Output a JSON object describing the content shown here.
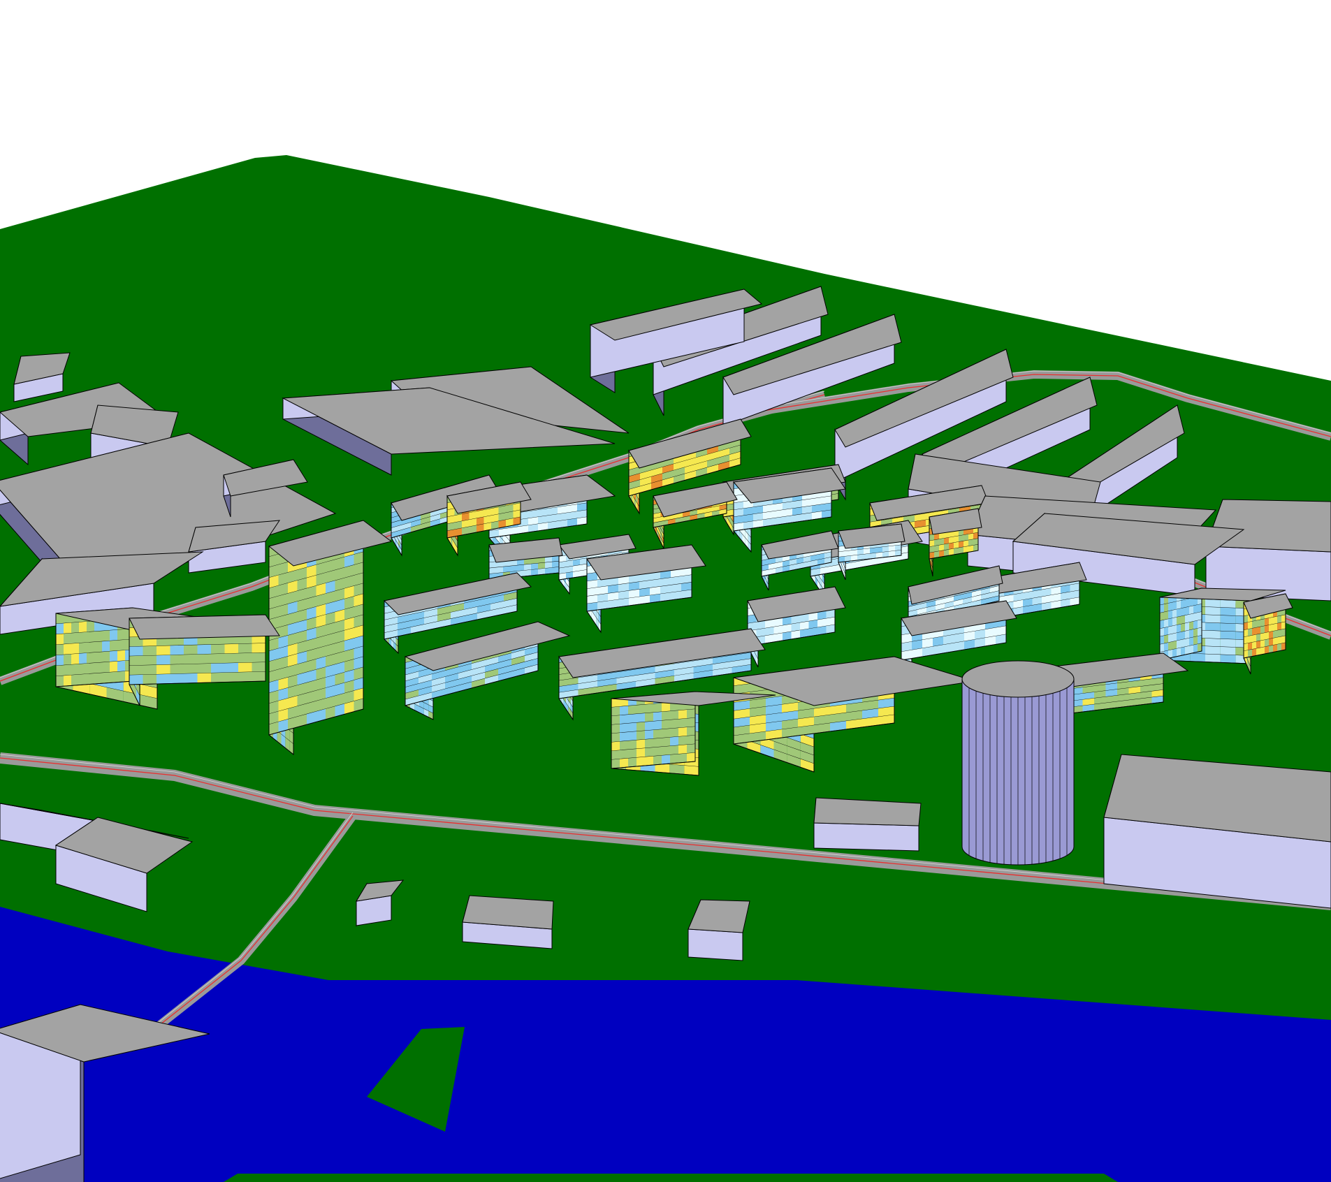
{
  "view": {
    "kind": "3d-urban-model-render",
    "palette": {
      "background": "#ffffff",
      "ground": "#007000",
      "water": "#0000c0",
      "road": "#9a9a9a",
      "road_line": "#e83030",
      "roof": "#a3a3a3",
      "wall_lit": "#c9c9f0",
      "wall_dark": "#6e6e9a",
      "outline": "#000000"
    },
    "facade_scale_colors": [
      "#e8fbff",
      "#b8e4f7",
      "#80c8ef",
      "#a0c878",
      "#f5e850",
      "#e89030"
    ]
  },
  "district": {
    "roads_count": 5,
    "buildings": [
      {
        "id": "b01",
        "style": "plain"
      },
      {
        "id": "b02",
        "style": "plain"
      },
      {
        "id": "b03",
        "style": "plain"
      },
      {
        "id": "b04",
        "style": "plain"
      },
      {
        "id": "b05",
        "style": "plain"
      },
      {
        "id": "b06",
        "style": "plain"
      },
      {
        "id": "b07",
        "style": "plain"
      },
      {
        "id": "b08",
        "style": "plain"
      },
      {
        "id": "b09",
        "style": "plain"
      },
      {
        "id": "b10",
        "style": "plain"
      },
      {
        "id": "b11",
        "style": "plain"
      },
      {
        "id": "b12",
        "style": "plain"
      },
      {
        "id": "b13",
        "style": "plain"
      },
      {
        "id": "b14",
        "style": "plain"
      },
      {
        "id": "b15",
        "style": "plain"
      },
      {
        "id": "b16",
        "style": "plain"
      },
      {
        "id": "b17",
        "style": "plain"
      },
      {
        "id": "b18",
        "style": "plain"
      },
      {
        "id": "b19",
        "style": "plain"
      },
      {
        "id": "b20",
        "style": "plain"
      },
      {
        "id": "b21",
        "style": "plain"
      },
      {
        "id": "b22",
        "style": "plain"
      },
      {
        "id": "b23",
        "style": "plain"
      },
      {
        "id": "b24",
        "style": "plain"
      },
      {
        "id": "b25",
        "style": "plain"
      },
      {
        "id": "b26",
        "style": "plain"
      },
      {
        "id": "b27",
        "style": "plain"
      },
      {
        "id": "b28",
        "style": "plain"
      },
      {
        "id": "b29",
        "style": "plain"
      },
      {
        "id": "b30",
        "style": "plain"
      },
      {
        "id": "b31",
        "style": "plain"
      },
      {
        "id": "h01",
        "style": "heatmap",
        "floors": 7,
        "tone": "light"
      },
      {
        "id": "h02",
        "style": "heatmap",
        "floors": 7,
        "tone": "light"
      },
      {
        "id": "h03",
        "style": "heatmap",
        "floors": 7,
        "tone": "light"
      },
      {
        "id": "h04",
        "style": "heatmap",
        "floors": 6,
        "tone": "light"
      },
      {
        "id": "h05",
        "style": "heatmap",
        "floors": 5,
        "tone": "light"
      },
      {
        "id": "h06",
        "style": "heatmap",
        "floors": 6,
        "tone": "light"
      },
      {
        "id": "h07",
        "style": "heatmap",
        "floors": 6,
        "tone": "light"
      },
      {
        "id": "h08",
        "style": "heatmap",
        "floors": 7,
        "tone": "warm"
      },
      {
        "id": "h09",
        "style": "heatmap",
        "floors": 6,
        "tone": "warm"
      },
      {
        "id": "h10",
        "style": "heatmap",
        "floors": 7,
        "tone": "warm"
      },
      {
        "id": "h11",
        "style": "heatmap",
        "floors": 6,
        "tone": "warm"
      },
      {
        "id": "h12",
        "style": "heatmap",
        "floors": 7,
        "tone": "warm"
      },
      {
        "id": "h13",
        "style": "heatmap",
        "floors": 6,
        "tone": "warm"
      },
      {
        "id": "h14",
        "style": "heatmap",
        "floors": 18,
        "tone": "green"
      },
      {
        "id": "h15",
        "style": "heatmap",
        "floors": 7,
        "tone": "green"
      },
      {
        "id": "h16",
        "style": "heatmap",
        "floors": 7,
        "tone": "green"
      },
      {
        "id": "h17",
        "style": "heatmap",
        "floors": 8,
        "tone": "green"
      },
      {
        "id": "h18",
        "style": "heatmap",
        "floors": 8,
        "tone": "green"
      },
      {
        "id": "h19",
        "style": "heatmap",
        "floors": 8,
        "tone": "blue"
      },
      {
        "id": "h20",
        "style": "heatmap",
        "floors": 7,
        "tone": "blue"
      },
      {
        "id": "h21",
        "style": "heatmap",
        "floors": 6,
        "tone": "blue"
      },
      {
        "id": "h22",
        "style": "heatmap",
        "floors": 7,
        "tone": "blue"
      },
      {
        "id": "h23",
        "style": "heatmap",
        "floors": 6,
        "tone": "blue"
      },
      {
        "id": "h24",
        "style": "heatmap",
        "floors": 6,
        "tone": "light"
      },
      {
        "id": "h25",
        "style": "heatmap",
        "floors": 6,
        "tone": "light"
      },
      {
        "id": "h26",
        "style": "heatmap",
        "floors": 6,
        "tone": "light"
      },
      {
        "id": "h27",
        "style": "heatmap",
        "floors": 7,
        "tone": "light"
      },
      {
        "id": "h28",
        "style": "heatmap",
        "floors": 8,
        "tone": "blue"
      },
      {
        "id": "h29",
        "style": "heatmap",
        "floors": 8,
        "tone": "warm"
      },
      {
        "id": "h30",
        "style": "heatmap",
        "floors": 8,
        "tone": "green"
      },
      {
        "id": "c01",
        "style": "cylinder"
      }
    ]
  }
}
